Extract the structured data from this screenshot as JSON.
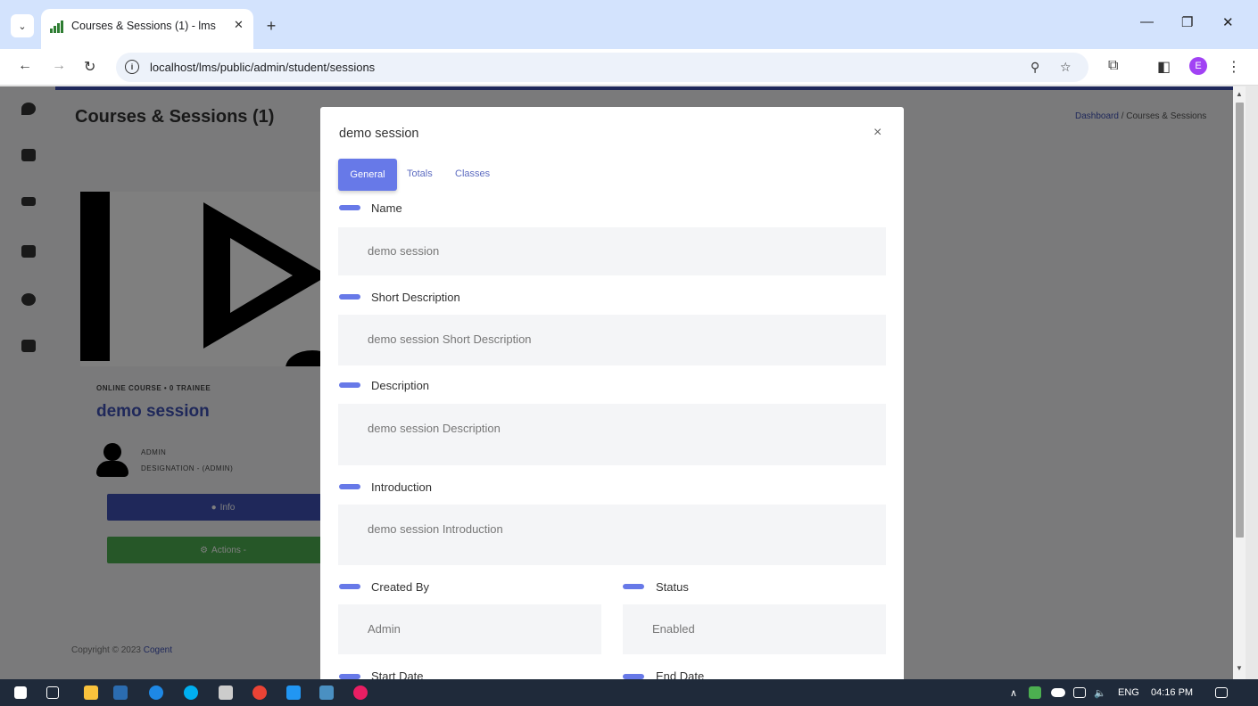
{
  "browser": {
    "tab_title": "Courses & Sessions (1) - lms",
    "url": "localhost/lms/public/admin/student/sessions",
    "profile_initial": "E"
  },
  "page": {
    "title": "Courses & Sessions (1)",
    "breadcrumb_home": "Dashboard",
    "breadcrumb_separator": "/",
    "breadcrumb_current": "Courses & Sessions"
  },
  "course_card": {
    "meta": "ONLINE COURSE • 0 TRAINEE",
    "title": "demo session",
    "author_name": "ADMIN",
    "author_designation": "DESIGNATION - (ADMIN)",
    "info_label": "Info",
    "actions_label": "Actions -"
  },
  "footer": {
    "copyright": "Copyright © 2023",
    "brand": "Cogent"
  },
  "modal": {
    "title": "demo session",
    "close": "×",
    "tabs": [
      "General",
      "Totals",
      "Classes"
    ],
    "fields": {
      "name": {
        "label": "Name",
        "value": "demo session"
      },
      "short_description": {
        "label": "Short Description",
        "value": "demo session Short Description"
      },
      "description": {
        "label": "Description",
        "value": "demo session Description"
      },
      "introduction": {
        "label": "Introduction",
        "value": "demo session Introduction"
      },
      "created_by": {
        "label": "Created By",
        "value": "Admin"
      },
      "status": {
        "label": "Status",
        "value": "Enabled"
      },
      "start_date": {
        "label": "Start Date"
      },
      "end_date": {
        "label": "End Date"
      }
    }
  },
  "taskbar": {
    "language": "ENG",
    "time": "04:16 PM"
  },
  "colors": {
    "primary": "#6779e8",
    "navy": "#3f51b5",
    "success": "#4caf50"
  }
}
